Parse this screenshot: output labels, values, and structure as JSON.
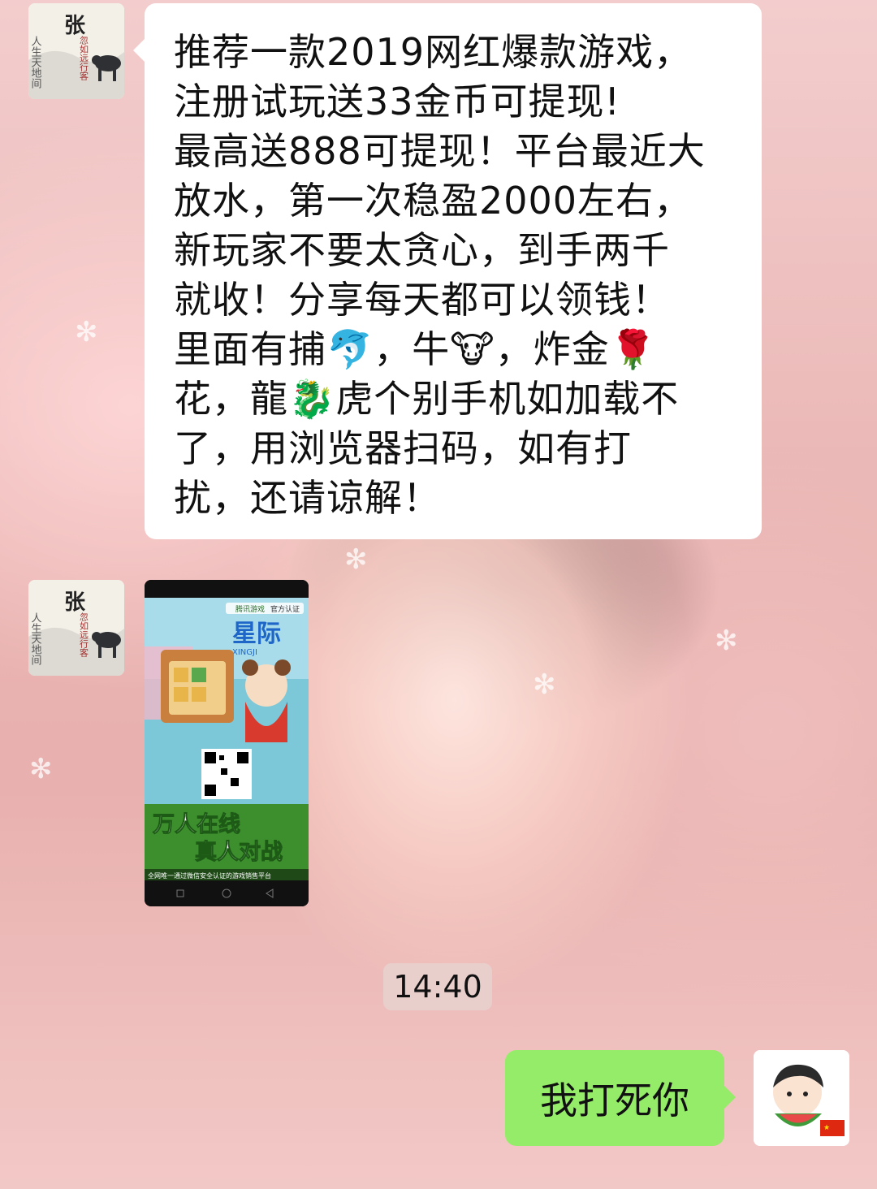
{
  "chat": {
    "incoming_text": "推荐一款2019网红爆款游戏，\n注册试玩送33金币可提现!\n最高送888可提现！平台最近大\n放水，第一次稳盈2000左右，\n新玩家不要太贪心，到手两千\n就收！分享每天都可以领钱！\n里面有捕🐬，牛🐮，炸金🌹\n花，龍🐉虎个别手机如加载不\n了，用浏览器扫码，如有打\n扰，还请谅解！",
    "timestamp": "14:40",
    "outgoing_text": "我打死你"
  },
  "sender_avatar": {
    "char": "张",
    "left_calligraphy": "人生天地间",
    "right_calligraphy": "忽如远行客"
  },
  "image_message": {
    "brand": "星际",
    "brand_en": "XINGJI",
    "top_label_1": "腾讯游戏",
    "top_label_2": "官方认证",
    "slogan_1": "万人在线",
    "slogan_2": "真人对战",
    "footer": "全网唯一通过微信安全认证的游戏销售平台"
  },
  "colors": {
    "bubble_incoming": "#ffffff",
    "bubble_outgoing": "#95ec69",
    "time_pill": "#e8d0cd"
  }
}
